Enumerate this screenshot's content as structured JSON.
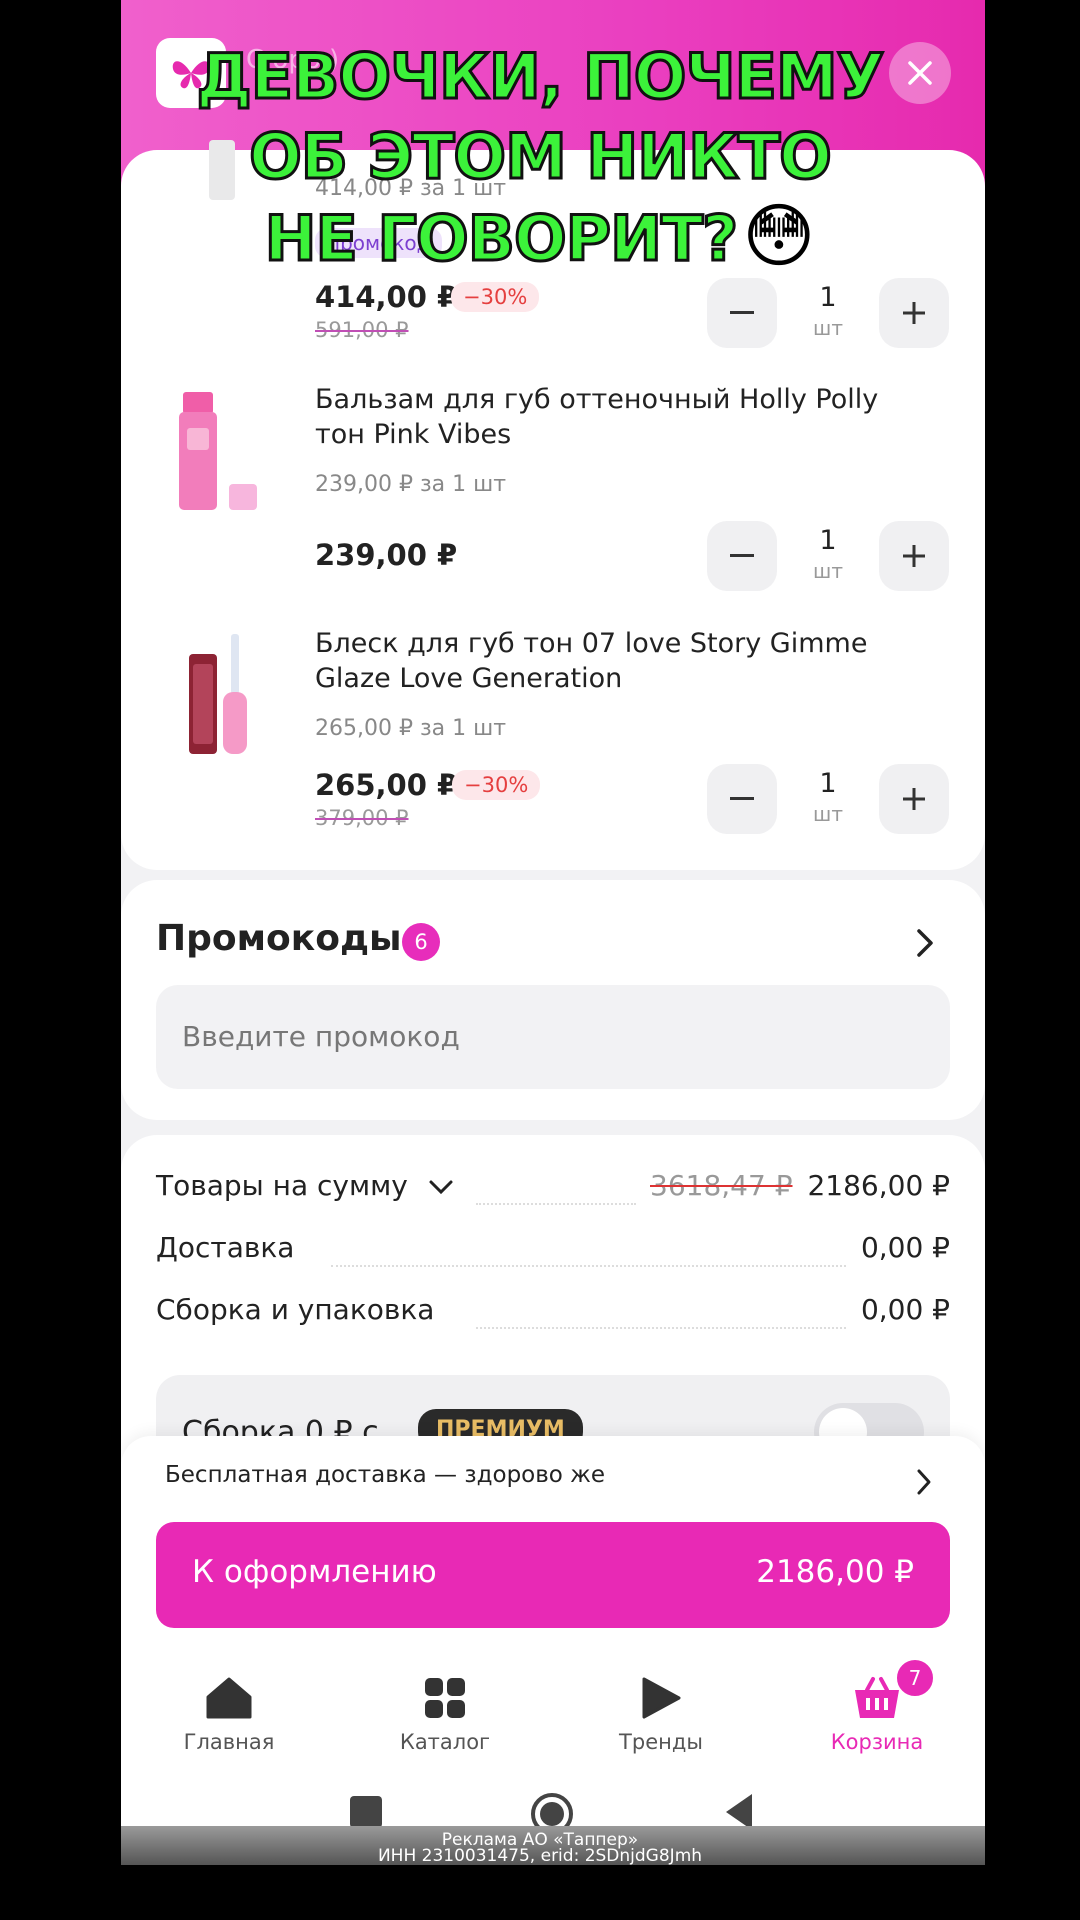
{
  "header": {
    "ghost_text": "С   оро   )"
  },
  "items": [
    {
      "unit_price": "414,00 ₽ за 1 шт",
      "badge": "промокод",
      "price": "414,00 ₽",
      "discount": "−30%",
      "old_price": "591,00 ₽",
      "qty": "1",
      "qty_unit": "шт"
    },
    {
      "name": "Бальзам для губ оттеночный Holly Polly тон Pink Vibes",
      "unit_price": "239,00 ₽ за 1 шт",
      "price": "239,00 ₽",
      "qty": "1",
      "qty_unit": "шт"
    },
    {
      "name": "Блеск для губ тон 07 love Story Gimme Glaze Love Generation",
      "unit_price": "265,00 ₽ за 1 шт",
      "price": "265,00 ₽",
      "discount": "−30%",
      "old_price": "379,00 ₽",
      "qty": "1",
      "qty_unit": "шт"
    }
  ],
  "promo": {
    "title": "Промокоды",
    "count": "6",
    "placeholder": "Введите промокод"
  },
  "summary": {
    "goods_label": "Товары на сумму",
    "goods_old": "3618,47 ₽",
    "goods_total": "2186,00 ₽",
    "delivery_label": "Доставка",
    "delivery_value": "0,00 ₽",
    "packing_label": "Сборка и упаковка",
    "packing_value": "0,00 ₽",
    "premium_text": "Сборка 0 ₽ с",
    "premium_badge": "ПРЕМИУМ"
  },
  "free_delivery": "Бесплатная доставка — здорово же",
  "checkout": {
    "label": "К оформлению",
    "total": "2186,00 ₽"
  },
  "nav": [
    {
      "label": "Главная",
      "icon": "home-icon"
    },
    {
      "label": "Каталог",
      "icon": "catalog-icon"
    },
    {
      "label": "Тренды",
      "icon": "play-icon"
    },
    {
      "label": "Корзина",
      "icon": "basket-icon",
      "badge": "7"
    }
  ],
  "colors": {
    "accent": "#e829b5",
    "discount": "#e53f3f",
    "overlay_text": "#3cf23a"
  },
  "overlay": {
    "line1": "ДЕВОЧКИ, ПОЧЕМУ",
    "line2": "ОБ ЭТОМ НИКТО",
    "line3": "НЕ ГОВОРИТ?",
    "emoji": "😳"
  },
  "ad": {
    "line1": "Реклама АО «Таппер»",
    "line2": "ИНН 2310031475, erid: 2SDnjdG8Jmh"
  }
}
